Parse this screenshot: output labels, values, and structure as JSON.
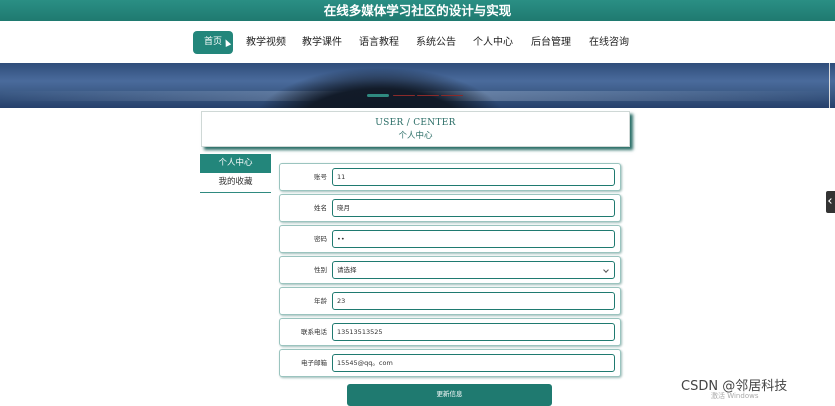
{
  "header": {
    "title": "在线多媒体学习社区的设计与实现"
  },
  "nav": {
    "items": [
      {
        "label": "首页",
        "active": true
      },
      {
        "label": "教学视频"
      },
      {
        "label": "教学课件"
      },
      {
        "label": "语言教程"
      },
      {
        "label": "系统公告"
      },
      {
        "label": "个人中心"
      },
      {
        "label": "后台管理"
      },
      {
        "label": "在线咨询"
      }
    ]
  },
  "page": {
    "title_en": "USER / CENTER",
    "title_cn": "个人中心"
  },
  "sidebar": {
    "items": [
      {
        "label": "个人中心",
        "active": true
      },
      {
        "label": "我的收藏"
      }
    ]
  },
  "form": {
    "fields": [
      {
        "label": "账号",
        "value": "11"
      },
      {
        "label": "姓名",
        "value": "晓月"
      },
      {
        "label": "密码",
        "value": "••"
      },
      {
        "label": "性别",
        "value": "请选择",
        "type": "select"
      },
      {
        "label": "年龄",
        "value": "23"
      },
      {
        "label": "联系电话",
        "value": "13513513525"
      },
      {
        "label": "电子邮箱",
        "value": "15545@qq。com"
      }
    ],
    "submit_label": "更新信息"
  },
  "watermark": {
    "text": "CSDN @邻居科技",
    "windows": "激活 Windows"
  },
  "colors": {
    "primary": "#23867b",
    "header": "#1f7a70"
  }
}
